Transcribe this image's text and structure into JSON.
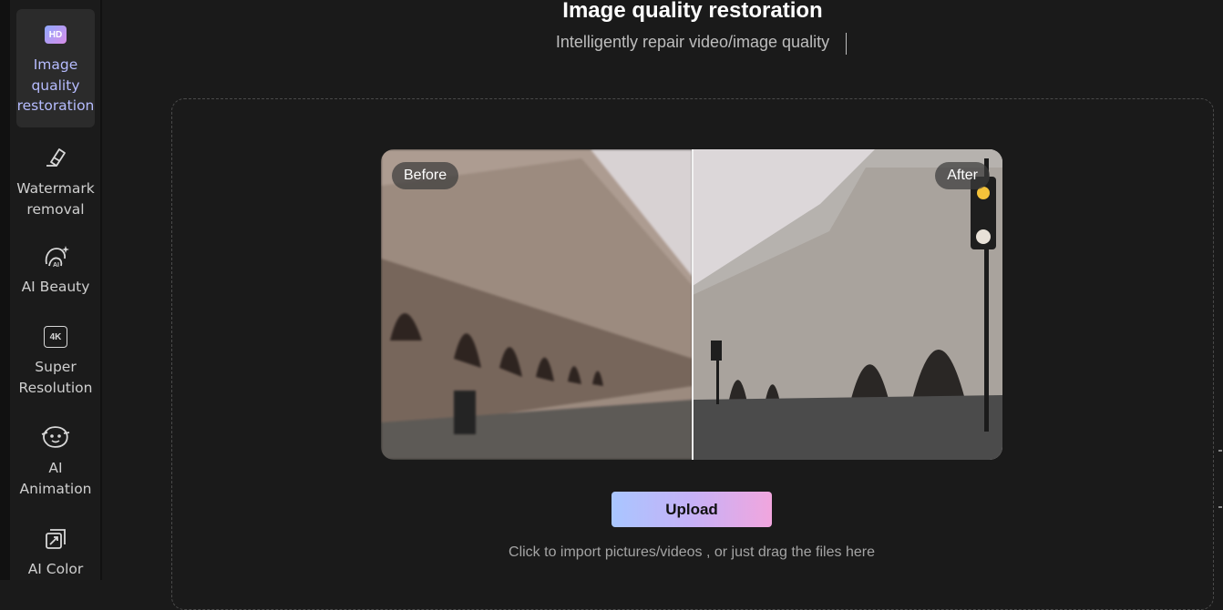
{
  "sidebar": {
    "items": [
      {
        "label": "Image\nquality\nrestoration",
        "icon": "hd-icon",
        "badge": "HD",
        "active": true
      },
      {
        "label": "Watermark\nremoval",
        "icon": "eraser-icon",
        "active": false
      },
      {
        "label": "AI Beauty",
        "icon": "ai-beauty-icon",
        "active": false
      },
      {
        "label": "Super\nResolution",
        "icon": "4k-icon",
        "badge": "4K",
        "active": false
      },
      {
        "label": "AI\nAnimation",
        "icon": "ai-animation-icon",
        "active": false
      },
      {
        "label": "AI Color",
        "icon": "ai-color-icon",
        "active": false
      }
    ]
  },
  "header": {
    "title": "Image quality restoration",
    "subtitle": "Intelligently repair video/image quality"
  },
  "preview": {
    "before_label": "Before",
    "after_label": "After",
    "divider_position": 0.5
  },
  "upload": {
    "button_label": "Upload",
    "hint": "Click to import pictures/videos , or just drag the files here"
  },
  "colors": {
    "accent_start": "#a9c6ff",
    "accent_end": "#f1a6de",
    "active_label": "#b6bcff",
    "background": "#1a1a1a"
  }
}
